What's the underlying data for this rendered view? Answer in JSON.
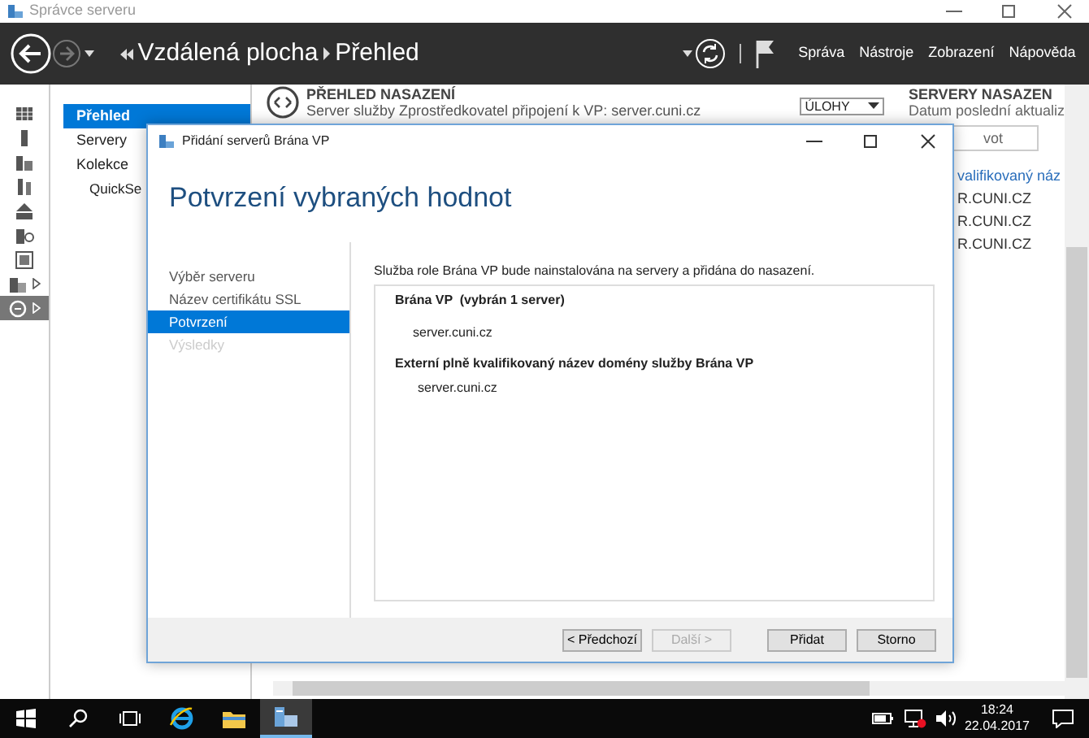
{
  "window": {
    "title": "Správce serveru"
  },
  "header": {
    "breadcrumb": [
      "Vzdálená plocha",
      "Přehled"
    ],
    "menu": [
      "Správa",
      "Nástroje",
      "Zobrazení",
      "Nápověda"
    ]
  },
  "rail": [
    {
      "selected": false,
      "expandable": false
    },
    {
      "selected": false,
      "expandable": false
    },
    {
      "selected": false,
      "expandable": false
    },
    {
      "selected": false,
      "expandable": false
    },
    {
      "selected": false,
      "expandable": false
    },
    {
      "selected": false,
      "expandable": false
    },
    {
      "selected": false,
      "expandable": false
    },
    {
      "selected": false,
      "expandable": true
    },
    {
      "selected": true,
      "expandable": true
    }
  ],
  "nav": [
    {
      "label": "Přehled",
      "selected": true
    },
    {
      "label": "Servery",
      "selected": false
    },
    {
      "label": "Kolekce",
      "selected": false,
      "children": [
        {
          "label": "QuickSe",
          "selected": false
        }
      ]
    }
  ],
  "overview": {
    "title": "PŘEHLED NASAZENÍ",
    "subtitle": "Server služby Zprostředkovatel připojení k VP: server.cuni.cz",
    "tasks": "ÚLOHY"
  },
  "servers_panel": {
    "title": "SERVERY NASAZEN",
    "subtitle": "Datum poslední aktualiz",
    "filter": "vot",
    "column": "valifikovaný náz",
    "rows": [
      "R.CUNI.CZ",
      "R.CUNI.CZ",
      "R.CUNI.CZ"
    ]
  },
  "dialog": {
    "title": "Přidání serverů Brána VP",
    "heading": "Potvrzení vybraných hodnot",
    "steps": [
      {
        "label": "Výběr serveru",
        "selected": false,
        "disabled": false
      },
      {
        "label": "Název certifikátu SSL",
        "selected": false,
        "disabled": false
      },
      {
        "label": "Potvrzení",
        "selected": true,
        "disabled": false
      },
      {
        "label": "Výsledky",
        "selected": false,
        "disabled": true
      }
    ],
    "description": "Služba role Brána VP bude nainstalována na servery a přidána do nasazení.",
    "sections": [
      {
        "heading": "Brána VP  (vybrán 1 server)",
        "value": "server.cuni.cz"
      },
      {
        "heading": "Externí plně kvalifikovaný název domény služby Brána VP",
        "value": "server.cuni.cz"
      }
    ],
    "buttons": [
      {
        "label": "< Předchozí",
        "disabled": false
      },
      {
        "label": "Další >",
        "disabled": true
      },
      {
        "label": "Přidat",
        "disabled": false
      },
      {
        "label": "Storno",
        "disabled": false
      }
    ]
  },
  "taskbar": {
    "apps": [
      {
        "kind": "ie",
        "selected": false
      },
      {
        "kind": "explorer",
        "selected": false
      },
      {
        "kind": "server",
        "selected": true
      }
    ],
    "time": "18:24",
    "date": "22.04.2017"
  }
}
